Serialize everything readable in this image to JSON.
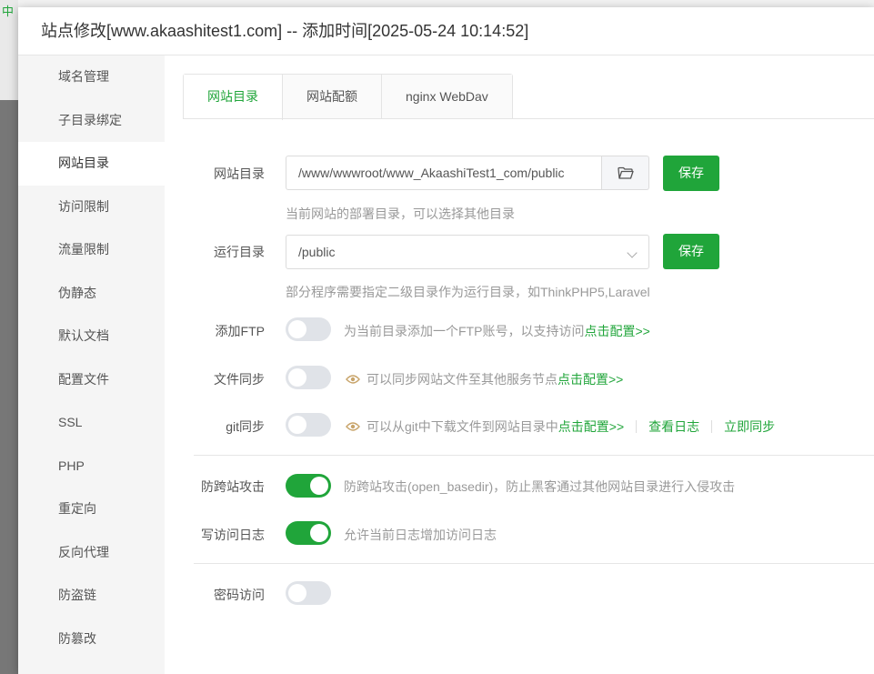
{
  "background": {
    "mark": "中"
  },
  "modal": {
    "title": "站点修改[www.akaashitest1.com] -- 添加时间[2025-05-24 10:14:52]"
  },
  "sidebar": {
    "items": [
      {
        "label": "域名管理",
        "active": false
      },
      {
        "label": "子目录绑定",
        "active": false
      },
      {
        "label": "网站目录",
        "active": true
      },
      {
        "label": "访问限制",
        "active": false
      },
      {
        "label": "流量限制",
        "active": false
      },
      {
        "label": "伪静态",
        "active": false
      },
      {
        "label": "默认文档",
        "active": false
      },
      {
        "label": "配置文件",
        "active": false
      },
      {
        "label": "SSL",
        "active": false
      },
      {
        "label": "PHP",
        "active": false
      },
      {
        "label": "重定向",
        "active": false
      },
      {
        "label": "反向代理",
        "active": false
      },
      {
        "label": "防盗链",
        "active": false
      },
      {
        "label": "防篡改",
        "active": false
      }
    ]
  },
  "tabs": [
    {
      "label": "网站目录",
      "active": true
    },
    {
      "label": "网站配额",
      "active": false
    },
    {
      "label": "nginx WebDav",
      "active": false
    }
  ],
  "site_dir": {
    "label": "网站目录",
    "value": "/www/wwwroot/www_AkaashiTest1_com/public",
    "folder_icon": "folder-icon",
    "save_label": "保存",
    "hint": "当前网站的部署目录，可以选择其他目录"
  },
  "run_dir": {
    "label": "运行目录",
    "value": "/public",
    "save_label": "保存",
    "hint": "部分程序需要指定二级目录作为运行目录，如ThinkPHP5,Laravel"
  },
  "ftp": {
    "label": "添加FTP",
    "enabled": false,
    "desc": "为当前目录添加一个FTP账号，以支持访问",
    "link": "点击配置>>"
  },
  "file_sync": {
    "label": "文件同步",
    "enabled": false,
    "icon": "eye-icon",
    "desc": "可以同步网站文件至其他服务节点",
    "link": "点击配置>>"
  },
  "git_sync": {
    "label": "git同步",
    "enabled": false,
    "icon": "eye-icon",
    "desc": "可以从git中下载文件到网站目录中",
    "link": "点击配置>>",
    "log_link": "查看日志",
    "sync_link": "立即同步"
  },
  "anti_xss": {
    "label": "防跨站攻击",
    "enabled": true,
    "desc": "防跨站攻击(open_basedir)，防止黑客通过其他网站目录进行入侵攻击"
  },
  "access_log": {
    "label": "写访问日志",
    "enabled": true,
    "desc": "允许当前日志增加访问日志"
  },
  "password_access": {
    "label": "密码访问",
    "enabled": false
  },
  "colors": {
    "accent": "#20a53a",
    "toggle_off": "#e0e3e8"
  }
}
